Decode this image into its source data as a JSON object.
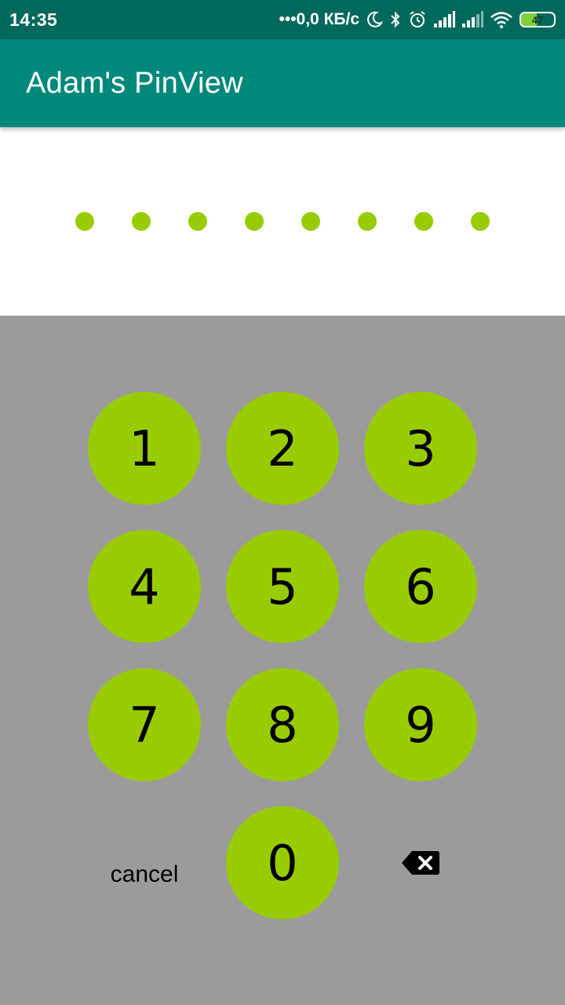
{
  "status_bar": {
    "time": "14:35",
    "network_speed": "•••0,0 КБ/с",
    "battery_level": "47",
    "icons": [
      "moon-icon",
      "bluetooth-icon",
      "alarm-icon",
      "signal-icon",
      "signal-icon",
      "wifi-icon",
      "battery-icon"
    ]
  },
  "app_bar": {
    "title": "Adam's PinView"
  },
  "pin": {
    "length": 8,
    "dot_color": "#99cc00"
  },
  "keypad": {
    "keys": [
      "1",
      "2",
      "3",
      "4",
      "5",
      "6",
      "7",
      "8",
      "9",
      "0"
    ],
    "cancel_label": "cancel",
    "backspace_icon": "backspace-icon",
    "key_color": "#99cc00",
    "background_color": "#9b9b9b"
  },
  "colors": {
    "status_bar": "#00695c",
    "app_bar": "#00897b"
  }
}
